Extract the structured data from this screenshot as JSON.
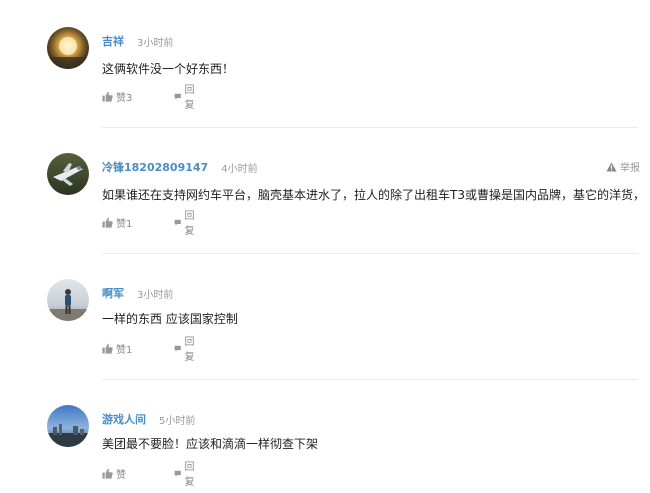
{
  "comments": [
    {
      "username": "吉祥",
      "time": "3小时前",
      "content": "这俩软件没一个好东西！",
      "like_label": "赞3",
      "reply_label": "回复",
      "avatar": "avatar-golden-orb",
      "show_report": false
    },
    {
      "username": "冷锋18202809147",
      "time": "4小时前",
      "content": "如果谁还在支持网约车平台，脑壳基本进水了，拉人的除了出租车T3或曹操是国内品牌，基它的洋货，",
      "like_label": "赞1",
      "reply_label": "回复",
      "report_label": "举报",
      "avatar": "avatar-aircraft",
      "show_report": true
    },
    {
      "username": "啊军",
      "time": "3小时前",
      "content": "一样的东西 应该国家控制",
      "like_label": "赞1",
      "reply_label": "回复",
      "avatar": "avatar-person-standing",
      "show_report": false
    },
    {
      "username": "游戏人间",
      "time": "5小时前",
      "content": "美团最不要脸！应该和滴滴一样彻查下架",
      "like_label": "赞",
      "reply_label": "回复",
      "avatar": "avatar-cityscape",
      "show_report": false
    }
  ],
  "colors": {
    "username": "#4a8ec5",
    "divider": "#ececec",
    "meta": "#999999"
  }
}
